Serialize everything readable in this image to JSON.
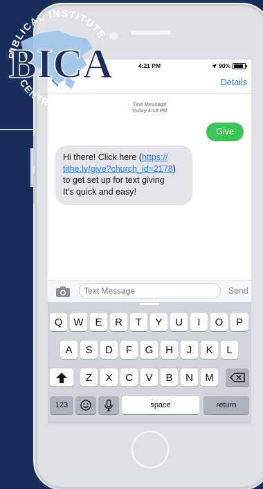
{
  "logo": {
    "arc_text": "BIBLICAL INSTITUTE OF CENTRAL AMERICA",
    "monogram": "BICA"
  },
  "status": {
    "time": "4:21 PM",
    "battery": "90%"
  },
  "nav": {
    "details": "Details"
  },
  "thread": {
    "meta_line1": "Text Message",
    "meta_line2": "Today 4:18 PM"
  },
  "messages": {
    "outgoing": "Give",
    "incoming": {
      "line1_prefix": "Hi there! Click here (",
      "link_line1": "https://",
      "link_line2": "tithe.ly/give?church_id=2178",
      "line2_suffix": ")",
      "line3": "to get set up for text giving",
      "line4": "It's quick and easy!"
    }
  },
  "composer": {
    "placeholder": "Text Message",
    "send": "Send"
  },
  "keyboard": {
    "row1": [
      "Q",
      "W",
      "E",
      "R",
      "T",
      "Y",
      "U",
      "I",
      "O",
      "P"
    ],
    "row2": [
      "A",
      "S",
      "D",
      "F",
      "G",
      "H",
      "J",
      "K",
      "L"
    ],
    "row3": [
      "Z",
      "X",
      "C",
      "V",
      "B",
      "N",
      "M"
    ],
    "numbers": "123",
    "space": "space",
    "return": "return"
  },
  "colors": {
    "background": "#1b2d5c",
    "accent_blue": "#1f7cf7",
    "bubble_green": "#39c654",
    "bubble_gray": "#e5e5ea"
  }
}
